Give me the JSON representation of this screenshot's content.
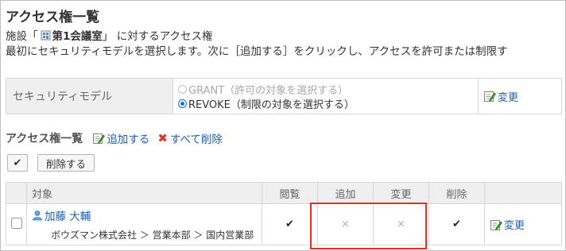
{
  "page": {
    "title": "アクセス権一覧",
    "line1_prefix": "施設「",
    "facility_name": "第1会議室",
    "line1_suffix": "」 に対するアクセス権",
    "line2": "最初にセキュリティモデルを選択します。次に［追加する］をクリックし、アクセスを許可または制限す"
  },
  "security_model": {
    "label": "セキュリティモデル",
    "options": [
      {
        "label": "GRANT（許可の対象を選択する）",
        "selected": false
      },
      {
        "label": "REVOKE（制限の対象を選択する）",
        "selected": true
      }
    ],
    "change_label": "変更"
  },
  "access_list": {
    "title": "アクセス権一覧",
    "add_label": "追加する",
    "delete_all_label": "すべて削除",
    "check_all_glyph": "✔",
    "delete_button_label": "削除する",
    "columns": {
      "target": "対象",
      "view": "閲覧",
      "add": "追加",
      "edit": "変更",
      "delete": "削除"
    },
    "rows": [
      {
        "user_name": "加藤 大輔",
        "org_path": "ボウズマン株式会社 ＞ 営業本部 ＞ 国内営業部",
        "view": "✔",
        "add": "×",
        "edit": "×",
        "delete": "✔",
        "change_label": "変更"
      }
    ]
  },
  "colors": {
    "link": "#1a5fb4",
    "header_bg": "#efefef",
    "highlight": "#e0302c",
    "delete_x": "#d83a2a"
  }
}
